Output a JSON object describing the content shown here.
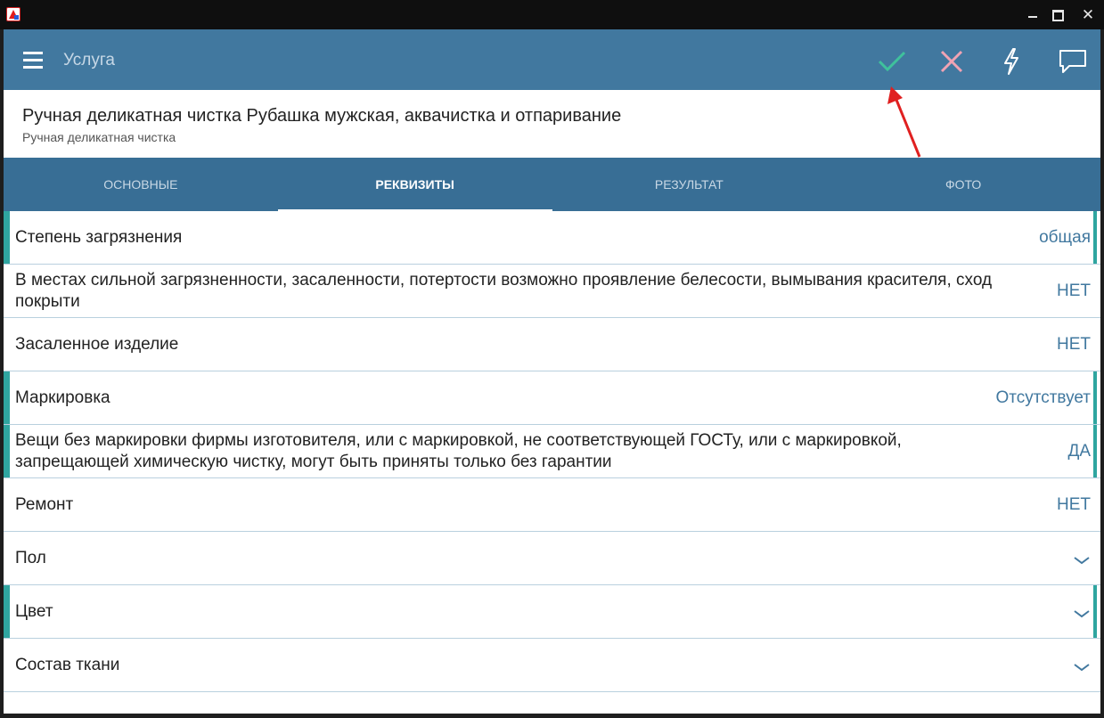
{
  "toolbar": {
    "title": "Услуга"
  },
  "header": {
    "title": "Ручная деликатная чистка Рубашка мужская, аквачистка и отпаривание",
    "subtitle": "Ручная деликатная чистка"
  },
  "tabs": [
    {
      "label": "ОСНОВНЫЕ",
      "active": false
    },
    {
      "label": "РЕКВИЗИТЫ",
      "active": true
    },
    {
      "label": "РЕЗУЛЬТАТ",
      "active": false
    },
    {
      "label": "ФОТО",
      "active": false
    }
  ],
  "rows": [
    {
      "label": "Степень загрязнения",
      "value": "общая",
      "marked": true
    },
    {
      "label": "В местах сильной загрязненности, засаленности, потертости возможно проявление белесости, вымывания красителя, сход покрыти",
      "value": "НЕТ",
      "marked": false
    },
    {
      "label": "Засаленное изделие",
      "value": "НЕТ",
      "marked": false
    },
    {
      "label": "Маркировка",
      "value": "Отсутствует",
      "marked": true
    },
    {
      "label": "Вещи без маркировки фирмы изготовителя, или с маркировкой, не соответствующей ГОСТу, или с маркировкой, запрещающей химическую чистку, могут быть приняты только без гарантии",
      "value": "ДА",
      "marked": true
    },
    {
      "label": "Ремонт",
      "value": "НЕТ",
      "marked": false
    },
    {
      "label": "Пол",
      "value": "",
      "marked": false
    },
    {
      "label": "Цвет",
      "value": "",
      "marked": true
    },
    {
      "label": "Состав ткани",
      "value": "",
      "marked": false
    }
  ],
  "icons": {
    "app": "app-logo-icon",
    "menu": "hamburger-menu-icon",
    "ok": "checkmark-icon",
    "cancel": "close-icon",
    "quick": "lightning-icon",
    "comment": "comment-icon",
    "chevron": "chevron-down-icon"
  },
  "colors": {
    "toolbar": "#41789f",
    "tabs": "#386e95",
    "accent": "#2fa5a0",
    "value_text": "#41789f",
    "ok_icon": "#3fc19c",
    "cancel_icon": "#f0a3b4",
    "annotation_arrow": "#e02020"
  }
}
